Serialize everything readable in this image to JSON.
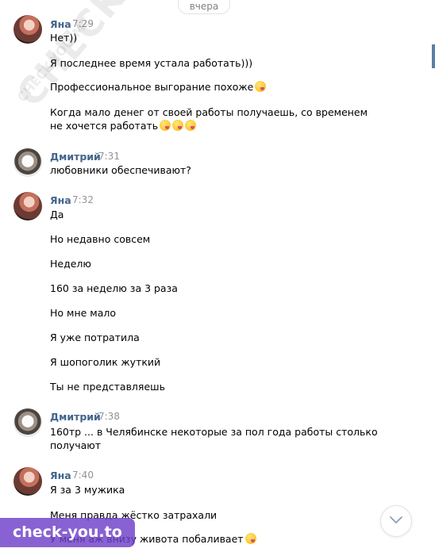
{
  "date_divider": "вчера",
  "watermark": "CHECK-YOU.ME",
  "brand_label": "check-you.to",
  "groups": [
    {
      "author": "Яна",
      "time": "7:29",
      "avatar": "yana-avatar",
      "messages": [
        "Нет))",
        "Я последнее время устала работать)))",
        "Профессиональное выгорание похоже",
        "Когда мало денег от своей работы получаешь, со временем",
        "не хочется работать"
      ]
    },
    {
      "author": "Дмитрий",
      "time": "7:31",
      "avatar": "dmitry-avatar",
      "messages": [
        "любовники обеспечивают?"
      ]
    },
    {
      "author": "Яна",
      "time": "7:32",
      "avatar": "yana-avatar",
      "messages": [
        "Да",
        "Но недавно совсем",
        "Неделю",
        "160 за неделю за 3 раза",
        "Но мне мало",
        "Я уже потратила",
        "Я шопоголик жуткий",
        "Ты не представляешь"
      ]
    },
    {
      "author": "Дмитрий",
      "time": "7:38",
      "avatar": "dmitry-avatar",
      "messages": [
        "160тр ... в Челябинске некоторые за пол года работы столько",
        "получают"
      ]
    },
    {
      "author": "Яна",
      "time": "7:40",
      "avatar": "yana-avatar",
      "messages": [
        "Я за 3 мужика",
        "Меня правда жёстко затрахали",
        "У меня аж внизу живота побаливает"
      ]
    }
  ]
}
